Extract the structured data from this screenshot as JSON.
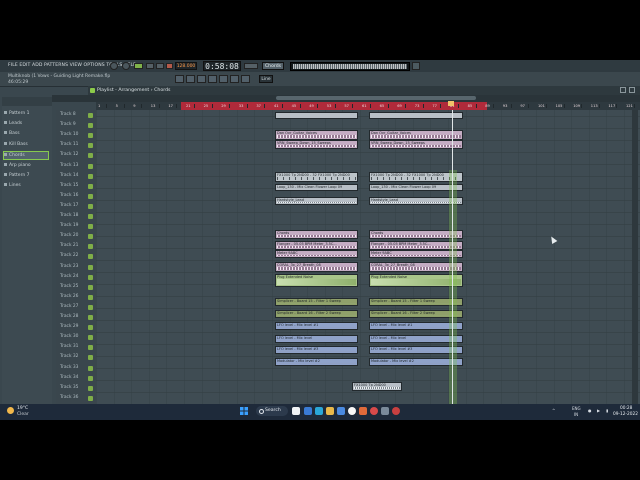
{
  "menu": "FILE EDIT ADD PATTERNS VIEW OPTIONS TOOLS HELP",
  "transport": {
    "tempo": "128.000",
    "time": "0:58:08",
    "pattern": "Chords",
    "snap": "Line"
  },
  "hint": {
    "line1": "Multiknob (1 Vows - Guiding Light Remake.flp",
    "line2": "46:05:29"
  },
  "playlist": {
    "title": "Playlist - Arrangement › Chords",
    "ruler_numbers": [
      "1",
      "5",
      "9",
      "13",
      "17",
      "21",
      "25",
      "29",
      "33",
      "37",
      "41",
      "45",
      "49",
      "53",
      "57",
      "61",
      "65",
      "69",
      "73",
      "77",
      "81",
      "85",
      "89",
      "93",
      "97",
      "101",
      "105",
      "109",
      "113",
      "117",
      "121"
    ]
  },
  "browser": {
    "items": [
      {
        "label": "Pattern 1"
      },
      {
        "label": "Leads"
      },
      {
        "label": "Bass"
      },
      {
        "label": "Kill Bass"
      },
      {
        "label": "Chords",
        "selected": true
      },
      {
        "label": "Arp piano"
      },
      {
        "label": "Pattern 7"
      },
      {
        "label": "Lines"
      }
    ]
  },
  "tracks": [
    "Track 8",
    "Track 9",
    "Track 10",
    "Track 11",
    "Track 12",
    "Track 13",
    "Track 14",
    "Track 15",
    "Track 16",
    "Track 17",
    "Track 18",
    "Track 19",
    "Track 20",
    "Track 21",
    "Track 22",
    "Track 23",
    "Track 24",
    "Track 25",
    "Track 26",
    "Track 27",
    "Track 28",
    "Track 29",
    "Track 30",
    "Track 31",
    "Track 32",
    "Track 33",
    "Track 34",
    "Track 35",
    "Track 36"
  ],
  "clips": {
    "left": [
      "",
      "Dan Ovr_Guitar_Voices",
      "VRN_Sweep_Down_15_Sweeps",
      "FX1000 Tp 2ND00 - 32 FX1000 Tp 2ND00",
      "Loop_130 - Mix Clean Flower Loop 09",
      "Hardstyle_Lead",
      "Chords",
      "Flanger - 05.05 BPM Meter_3.5C...",
      "Meter 9ABC",
      "CORAL_3x_27_Breath_08",
      "Plug Extended Noise",
      "Simplicer - Board 15 - Filter 1 Sweep",
      "Simplicer - Board 16 - Filter 2 Sweep",
      "LFO level - Mix level #1",
      "LFO level - Mix level",
      "LFO level - Mix level #3",
      "Modulator - Mix level #2",
      "FX1000 Tp 2ND00"
    ],
    "right": [
      "",
      "Dan Ovr_Guitar_Voices",
      "VRN_Sweep_Down_15_Sweeps",
      "FX1000 Tp 2ND00 - 32 FX1000 Tp 2ND00",
      "Loop_130 - Mix Clean Flower Loop 09",
      "Hardstyle_Lead",
      "Chords",
      "Flanger - 05.05 BPM Meter_3.5C...",
      "Meter 9ABC",
      "CORAL_3x_27_Breath_08",
      "Plug Extended Noise",
      "Simplicer - Board 15 - Filter 1 Sweep",
      "Simplicer - Board 16 - Filter 2 Sweep",
      "LFO level - Mix level #1",
      "LFO level - Mix level",
      "LFO level - Mix level #3",
      "Modulator - Mix level #2",
      ""
    ]
  },
  "taskbar": {
    "weather_temp": "19°C",
    "weather_cond": "Clear",
    "search": "Search",
    "lang": "ENG",
    "lang2": "IN",
    "time": "00:28",
    "date": "09-12-2022"
  },
  "colors": {
    "accent_green": "#87c94f",
    "ruler_red": "#b02a3a",
    "pink_clip": "#c4acc3",
    "blue_clip": "#8fa2c9",
    "olive_clip": "#8fa06a"
  }
}
